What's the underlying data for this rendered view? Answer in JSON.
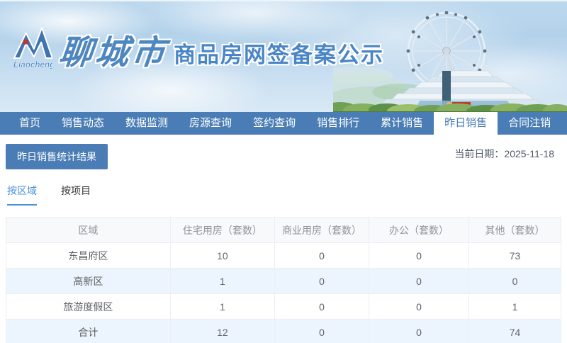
{
  "colors": {
    "nav_blue": "#4a7db5",
    "accent_blue": "#4a90d9",
    "title_blue": "#4a86c6",
    "stripe_blue": "#ecf5fd",
    "border_gray": "#ebeef5",
    "header_text_gray": "#909399",
    "cell_text_gray": "#606266",
    "date_text": "#4e5969",
    "logo_red": "#c53030"
  },
  "header": {
    "logo_text": "Liaocheng",
    "city_name": "聊城市",
    "site_title": "商品房网签备案公示"
  },
  "nav": {
    "items": [
      {
        "label": "首页",
        "active": false
      },
      {
        "label": "销售动态",
        "active": false
      },
      {
        "label": "数据监测",
        "active": false
      },
      {
        "label": "房源查询",
        "active": false
      },
      {
        "label": "签约查询",
        "active": false
      },
      {
        "label": "销售排行",
        "active": false
      },
      {
        "label": "累计销售",
        "active": false
      },
      {
        "label": "昨日销售",
        "active": true
      },
      {
        "label": "合同注销",
        "active": false
      }
    ]
  },
  "content": {
    "section_button": "昨日销售统计结果",
    "date_label": "当前日期：",
    "date_value": "2025-11-18",
    "tabs": [
      {
        "label": "按区域",
        "active": true
      },
      {
        "label": "按项目",
        "active": false
      }
    ]
  },
  "table": {
    "headers": [
      "区域",
      "住宅用房（套数）",
      "商业用房（套数）",
      "办公（套数）",
      "其他（套数）"
    ],
    "rows": [
      {
        "region": "东昌府区",
        "residential": "10",
        "commercial": "0",
        "office": "0",
        "other": "73"
      },
      {
        "region": "高新区",
        "residential": "1",
        "commercial": "0",
        "office": "0",
        "other": "0"
      },
      {
        "region": "旅游度假区",
        "residential": "1",
        "commercial": "0",
        "office": "0",
        "other": "1"
      },
      {
        "region": "合计",
        "residential": "12",
        "commercial": "0",
        "office": "0",
        "other": "74"
      }
    ]
  }
}
